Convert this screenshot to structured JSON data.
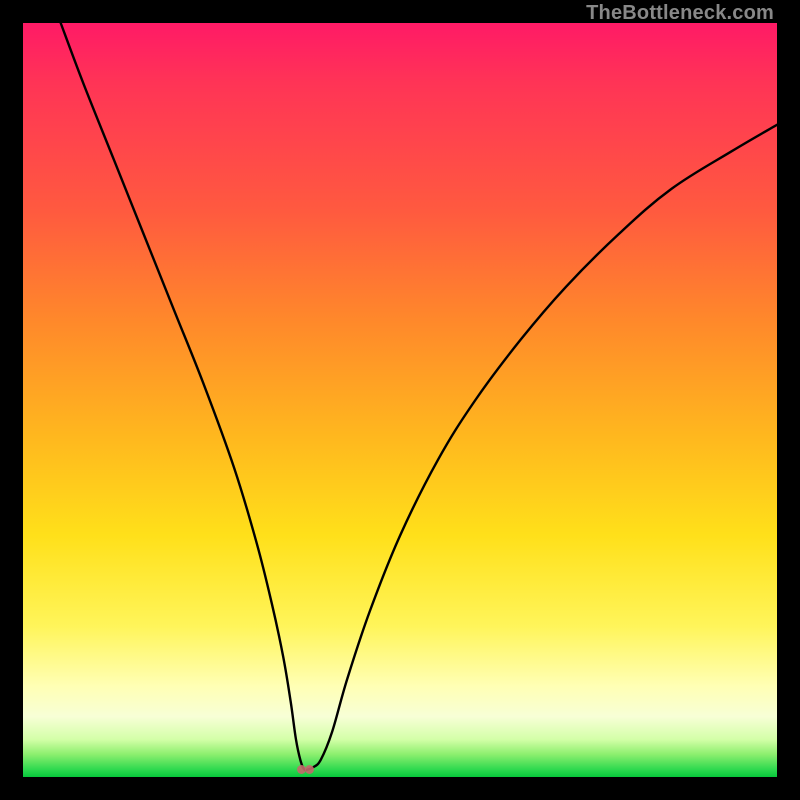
{
  "watermark": "TheBottleneck.com",
  "chart_data": {
    "type": "line",
    "title": "",
    "xlabel": "",
    "ylabel": "",
    "xlim": [
      0,
      100
    ],
    "ylim": [
      0,
      100
    ],
    "grid": false,
    "legend": false,
    "series": [
      {
        "name": "bottleneck-curve",
        "x": [
          5,
          8,
          12,
          16,
          20,
          24,
          28,
          31,
          33,
          34.5,
          35.5,
          36.2,
          36.8,
          37.3,
          37.8,
          38.5,
          39.5,
          41,
          43,
          46,
          50,
          55,
          60,
          66,
          72,
          79,
          86,
          94,
          100
        ],
        "y": [
          100,
          92,
          82,
          72,
          62,
          52,
          41,
          31,
          23,
          16,
          10,
          5,
          2.2,
          1.0,
          1.0,
          1.3,
          2.3,
          6,
          13,
          22,
          32,
          42,
          50,
          58,
          65,
          72,
          78,
          83,
          86.5
        ]
      }
    ],
    "annotations": [
      {
        "name": "min-marker",
        "x": 37.5,
        "y": 1.0
      }
    ],
    "colors": {
      "curve": "#000000",
      "marker": "#c36a6c",
      "gradient_top": "#ff1a66",
      "gradient_bottom": "#07c73b"
    }
  }
}
